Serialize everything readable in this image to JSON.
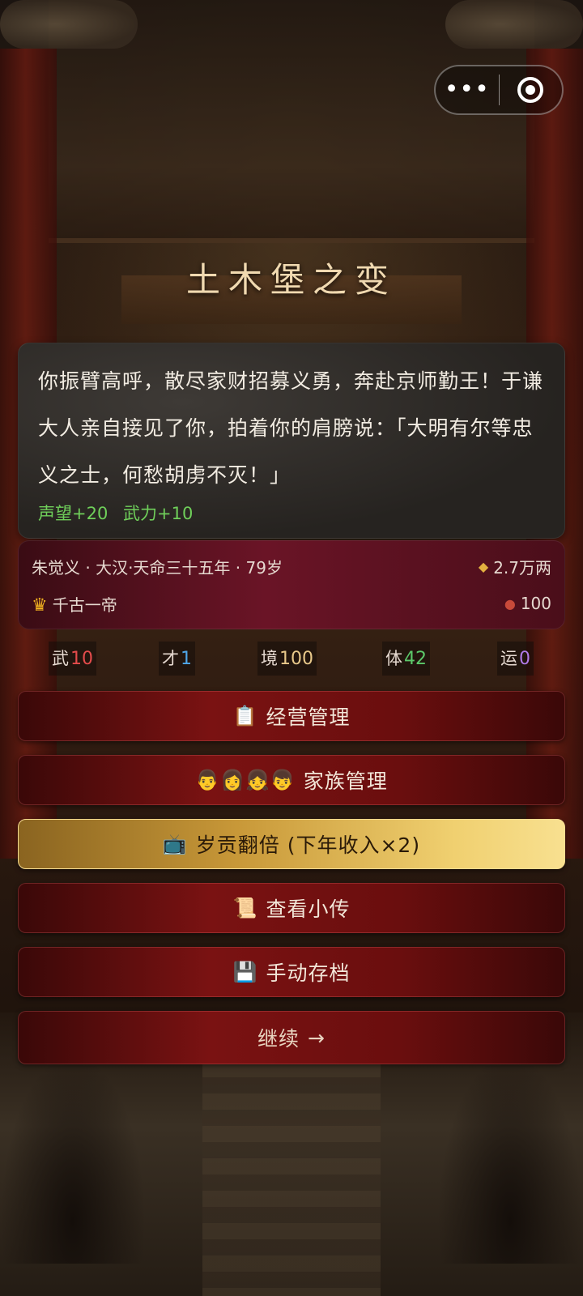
{
  "title": "土木堡之变",
  "capsule": {
    "more_icon": "more-dots-icon",
    "close_icon": "target-close-icon"
  },
  "story": {
    "text": "你振臂高呼，散尽家财招募义勇，奔赴京师勤王！于谦大人亲自接见了你，拍着你的肩膀说：「大明有尔等忠义之士，何愁胡虏不灭！」",
    "effects": [
      "声望+20",
      "武力+10"
    ]
  },
  "info": {
    "line1": "朱觉义 · 大汉·天命三十五年 · 79岁",
    "title_label": "千古一帝",
    "money": "2.7万两",
    "item_count": "100"
  },
  "stats": [
    {
      "label": "武",
      "value": "10",
      "color": "#e34b4b"
    },
    {
      "label": "才",
      "value": "1",
      "color": "#4fa6e8"
    },
    {
      "label": "境",
      "value": "100",
      "color": "#e8c88a"
    },
    {
      "label": "体",
      "value": "42",
      "color": "#5cc86a"
    },
    {
      "label": "运",
      "value": "0",
      "color": "#b07ae8"
    }
  ],
  "buttons": {
    "manage": {
      "icon": "📋",
      "label": "经营管理"
    },
    "family": {
      "icon": "👨👩👧👦",
      "label": "家族管理"
    },
    "tribute": {
      "icon": "📺",
      "label": "岁贡翻倍 (下年收入×2)"
    },
    "bio": {
      "icon": "📜",
      "label": "查看小传"
    },
    "save": {
      "icon": "💾",
      "label": "手动存档"
    },
    "continue": {
      "label": "继续",
      "arrow": "→"
    }
  }
}
